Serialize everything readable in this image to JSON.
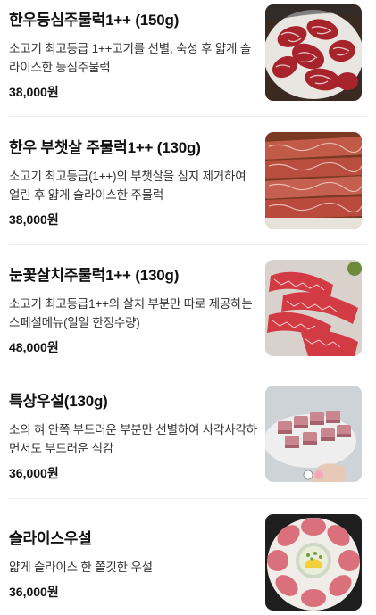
{
  "menu": {
    "items": [
      {
        "name": "한우등심주물럭1++ (150g)",
        "desc": "소고기 최고등급 1++고기를 선별, 숙성 후 얇게 슬라이스한 등심주물럭",
        "price": "38,000원"
      },
      {
        "name": "한우 부챗살 주물럭1++ (130g)",
        "desc": "소고기 최고등급(1++)의 부챗살을 심지 제거하여 얼린 후 얇게 슬라이스한 주물럭",
        "price": "38,000원"
      },
      {
        "name": "눈꽃살치주물럭1++ (130g)",
        "desc": "소고기 최고등급1++의 살치 부분만 따로 제공하는 스페셜메뉴(일일 한정수량)",
        "price": "48,000원"
      },
      {
        "name": "특상우설(130g)",
        "desc": "소의 혀 안쪽 부드러운 부분만 선별하여 사각사각하면서도 부드러운 식감",
        "price": "36,000원"
      },
      {
        "name": "슬라이스우설",
        "desc": "얇게 슬라이스 한 쫄깃한 우설",
        "price": "36,000원"
      }
    ]
  }
}
